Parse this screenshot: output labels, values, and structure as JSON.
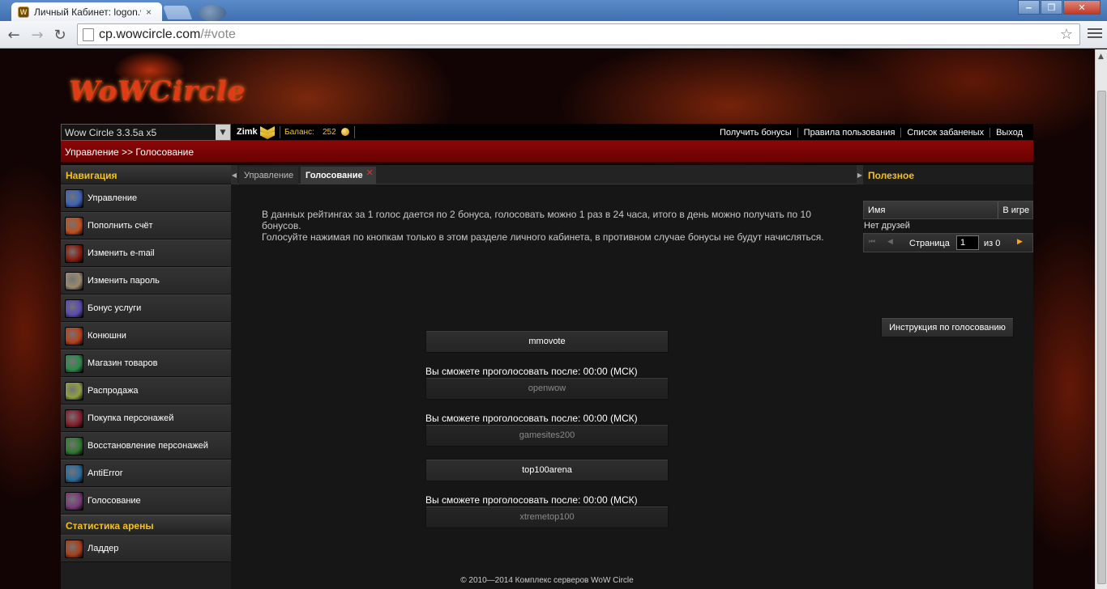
{
  "browser": {
    "tab_title": "Личный Кабинет: logon.w",
    "tab_close": "×",
    "url_host": "cp.wowcircle.com",
    "url_path": "/#vote",
    "back": "←",
    "forward": "→",
    "reload": "↻",
    "star": "☆",
    "minimize": "‒",
    "maximize": "❐",
    "close": "✕"
  },
  "site": {
    "logo_text": "WoWCircle",
    "server": "Wow Circle 3.3.5a x5",
    "server_arrow": "▼",
    "username": "Zimk",
    "balance_label": "Баланс:",
    "balance_value": "252",
    "top_links": [
      "Получить бонусы",
      "Правила пользования",
      "Список забаненых",
      "Выход"
    ],
    "breadcrumb": "Управление >> Голосование"
  },
  "leftnav": {
    "header": "Навигация",
    "items": [
      {
        "label": "Управление",
        "icon": "management-icon",
        "color": "#3d63b8"
      },
      {
        "label": "Пополнить счёт",
        "icon": "deposit-icon",
        "color": "#c0501c"
      },
      {
        "label": "Изменить e-mail",
        "icon": "email-icon",
        "color": "#8a1c10"
      },
      {
        "label": "Изменить пароль",
        "icon": "password-icon",
        "color": "#9a8a70"
      },
      {
        "label": "Бонус услуги",
        "icon": "bonus-services-icon",
        "color": "#5a4ab0"
      },
      {
        "label": "Конюшни",
        "icon": "stables-icon",
        "color": "#b8401a"
      },
      {
        "label": "Магазин товаров",
        "icon": "shop-icon",
        "color": "#2c8a4a"
      },
      {
        "label": "Распродажа",
        "icon": "sale-icon",
        "color": "#8ea040"
      },
      {
        "label": "Покупка персонажей",
        "icon": "buy-character-icon",
        "color": "#8a1e2c"
      },
      {
        "label": "Восстановление персонажей",
        "icon": "restore-character-icon",
        "color": "#2f7a2f"
      },
      {
        "label": "AntiError",
        "icon": "antierror-icon",
        "color": "#2a6c9a"
      },
      {
        "label": "Голосование",
        "icon": "voting-icon",
        "color": "#7a3a7a"
      }
    ],
    "arena_header": "Статистика арены",
    "arena_items": [
      {
        "label": "Ладдер",
        "icon": "ladder-icon",
        "color": "#a8401a"
      }
    ]
  },
  "center": {
    "tab_inactive": "Управление",
    "tab_active": "Голосование",
    "tab_close": "✕",
    "edge_left": "◀",
    "edge_right": "▶",
    "info_line1": "В данных рейтингах за 1 голос дается по 2 бонуса, голосовать можно 1 раз в 24 часа, итого в день можно получать по 10 бонусов.",
    "info_line2": "Голосуйте нажимая по кнопкам только в этом разделе личного кабинета, в противном случае бонусы не будут начисляться.",
    "wait_message": "Вы сможете проголосовать после: 00:00 (МСК)",
    "vote_sites": [
      {
        "label": "mmovote",
        "active": true
      },
      {
        "label": "openwow",
        "active": false
      },
      {
        "label": "gamesites200",
        "active": false
      },
      {
        "label": "top100arena",
        "active": true
      },
      {
        "label": "xtremetop100",
        "active": false
      }
    ],
    "footer": "© 2010—2014 Комплекс серверов WoW Circle"
  },
  "rightpanel": {
    "header": "Полезное",
    "col_name": "Имя",
    "col_ingame": "В игре",
    "no_friends": "Нет друзей",
    "pager_first": "⏮",
    "pager_prev": "◀",
    "page_label": "Страница",
    "page_value": "1",
    "page_of": "из 0",
    "pager_next": "▶",
    "instruction_button": "Инструкция по голосованию"
  }
}
